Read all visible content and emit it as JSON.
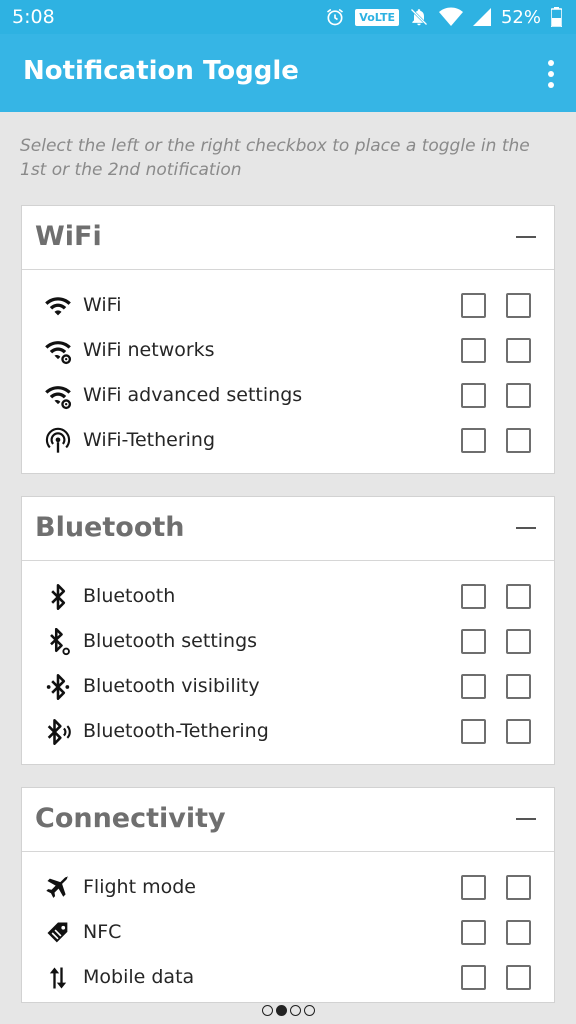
{
  "status": {
    "time": "5:08",
    "volte": "VoLTE",
    "battery": "52%",
    "icons": [
      "alarm-icon",
      "volte-badge",
      "notifications-off-icon",
      "wifi-signal-icon",
      "cell-signal-icon",
      "battery-icon"
    ]
  },
  "appbar": {
    "title": "Notification Toggle",
    "menu_icon": "more-vert-icon"
  },
  "instructions": "Select the left or the right checkbox to place a toggle in the 1st or the 2nd notification",
  "sections": [
    {
      "title": "WiFi",
      "items": [
        {
          "label": "WiFi",
          "icon": "wifi-icon",
          "left": false,
          "right": false
        },
        {
          "label": "WiFi networks",
          "icon": "wifi-settings-icon",
          "left": false,
          "right": false
        },
        {
          "label": "WiFi advanced settings",
          "icon": "wifi-settings-icon",
          "left": false,
          "right": false
        },
        {
          "label": "WiFi-Tethering",
          "icon": "hotspot-icon",
          "left": false,
          "right": false
        }
      ]
    },
    {
      "title": "Bluetooth",
      "items": [
        {
          "label": "Bluetooth",
          "icon": "bluetooth-icon",
          "left": false,
          "right": false
        },
        {
          "label": "Bluetooth settings",
          "icon": "bluetooth-settings-icon",
          "left": false,
          "right": false
        },
        {
          "label": "Bluetooth visibility",
          "icon": "bluetooth-visibility-icon",
          "left": false,
          "right": false
        },
        {
          "label": "Bluetooth-Tethering",
          "icon": "bluetooth-tethering-icon",
          "left": false,
          "right": false
        }
      ]
    },
    {
      "title": "Connectivity",
      "items": [
        {
          "label": "Flight mode",
          "icon": "airplane-icon",
          "left": false,
          "right": false
        },
        {
          "label": "NFC",
          "icon": "nfc-icon",
          "left": false,
          "right": false
        },
        {
          "label": "Mobile data",
          "icon": "mobile-data-icon",
          "left": false,
          "right": false
        }
      ]
    }
  ],
  "pager": {
    "count": 4,
    "active": 1
  }
}
